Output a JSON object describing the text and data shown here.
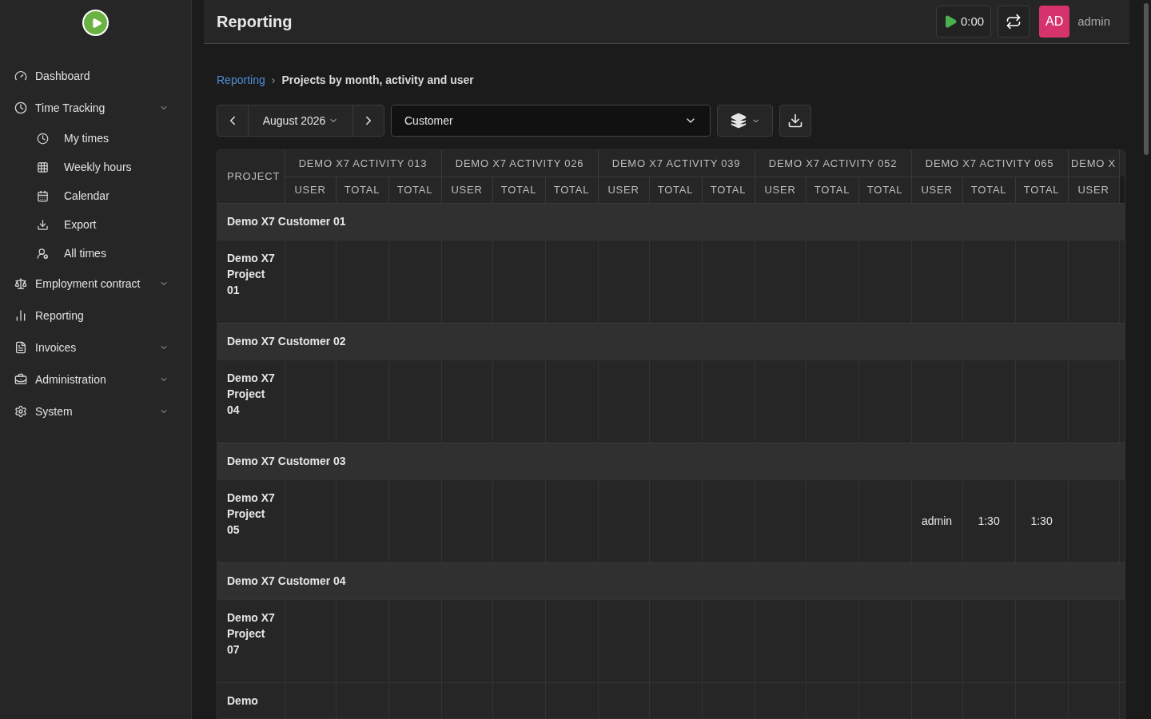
{
  "sidebar": {
    "items": [
      {
        "label": "Dashboard",
        "expandable": false
      },
      {
        "label": "Time Tracking",
        "expandable": true,
        "children": [
          {
            "label": "My times"
          },
          {
            "label": "Weekly hours"
          },
          {
            "label": "Calendar"
          },
          {
            "label": "Export"
          },
          {
            "label": "All times"
          }
        ]
      },
      {
        "label": "Employment contract",
        "expandable": true
      },
      {
        "label": "Reporting",
        "expandable": false
      },
      {
        "label": "Invoices",
        "expandable": true
      },
      {
        "label": "Administration",
        "expandable": true
      },
      {
        "label": "System",
        "expandable": true
      }
    ]
  },
  "header": {
    "title": "Reporting",
    "timer": "0:00",
    "avatar": "AD",
    "user": "admin"
  },
  "breadcrumb": {
    "link": "Reporting",
    "separator": "›",
    "current": "Projects by month, activity and user"
  },
  "toolbar": {
    "month": "August 2026",
    "group_by": "Customer"
  },
  "table": {
    "project_header": "PROJECT",
    "activities": [
      {
        "name": "DEMO X7 ACTIVITY 013",
        "columns": [
          "USER",
          "TOTAL",
          "TOTAL"
        ]
      },
      {
        "name": "DEMO X7 ACTIVITY 026",
        "columns": [
          "USER",
          "TOTAL",
          "TOTAL"
        ]
      },
      {
        "name": "DEMO X7 ACTIVITY 039",
        "columns": [
          "USER",
          "TOTAL",
          "TOTAL"
        ]
      },
      {
        "name": "DEMO X7 ACTIVITY 052",
        "columns": [
          "USER",
          "TOTAL",
          "TOTAL"
        ]
      },
      {
        "name": "DEMO X7 ACTIVITY 065",
        "columns": [
          "USER",
          "TOTAL",
          "TOTAL"
        ]
      },
      {
        "name": "DEMO X",
        "columns": [
          "USER"
        ]
      }
    ],
    "rows": [
      {
        "kind": "customer",
        "name": "Demo X7 Customer 01"
      },
      {
        "kind": "project",
        "name": "Demo X7 Project 01"
      },
      {
        "kind": "customer",
        "name": "Demo X7 Customer 02"
      },
      {
        "kind": "project",
        "name": "Demo X7 Project 04"
      },
      {
        "kind": "customer",
        "name": "Demo X7 Customer 03"
      },
      {
        "kind": "project",
        "name": "Demo X7 Project 05",
        "cells": [
          null,
          null,
          null,
          null,
          null,
          null,
          null,
          null,
          null,
          null,
          null,
          null,
          "admin",
          "1:30",
          "1:30",
          null
        ]
      },
      {
        "kind": "customer",
        "name": "Demo X7 Customer 04"
      },
      {
        "kind": "project",
        "name": "Demo X7 Project 07"
      },
      {
        "kind": "project",
        "name": "Demo"
      }
    ]
  }
}
